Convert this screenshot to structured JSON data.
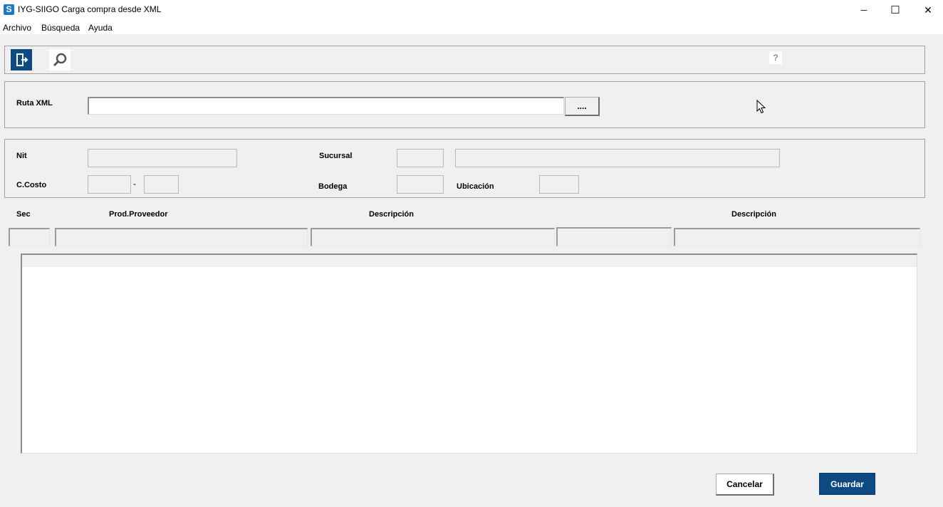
{
  "window": {
    "title": "IYG-SIIGO Carga compra desde XML",
    "app_icon_letter": "S",
    "controls": {
      "minimize": "─",
      "maximize": "☐",
      "close": "✕"
    }
  },
  "menu": {
    "items": [
      "Archivo",
      "Búsqueda",
      "Ayuda"
    ]
  },
  "toolbar": {
    "exit_icon": "exit-door-icon",
    "search_icon": "magnifier-icon",
    "help_label": "?",
    "accent": "#0d4a82"
  },
  "xml": {
    "label": "Ruta XML",
    "value": "",
    "browse_label": "...."
  },
  "info": {
    "nit_label": "Nit",
    "sucursal_label": "Sucursal",
    "ccosto_label": "C.Costo",
    "ccosto_separator": "-",
    "bodega_label": "Bodega",
    "ubicacion_label": "Ubicación"
  },
  "line_headers": {
    "sec": "Sec",
    "prod_proveedor": "Prod.Proveedor",
    "descripcion_1": "Descripción",
    "descripcion_2": "Descripción"
  },
  "actions": {
    "cancel_label": "Cancelar",
    "save_label": "Guardar",
    "save_color": "#0d4a82"
  }
}
